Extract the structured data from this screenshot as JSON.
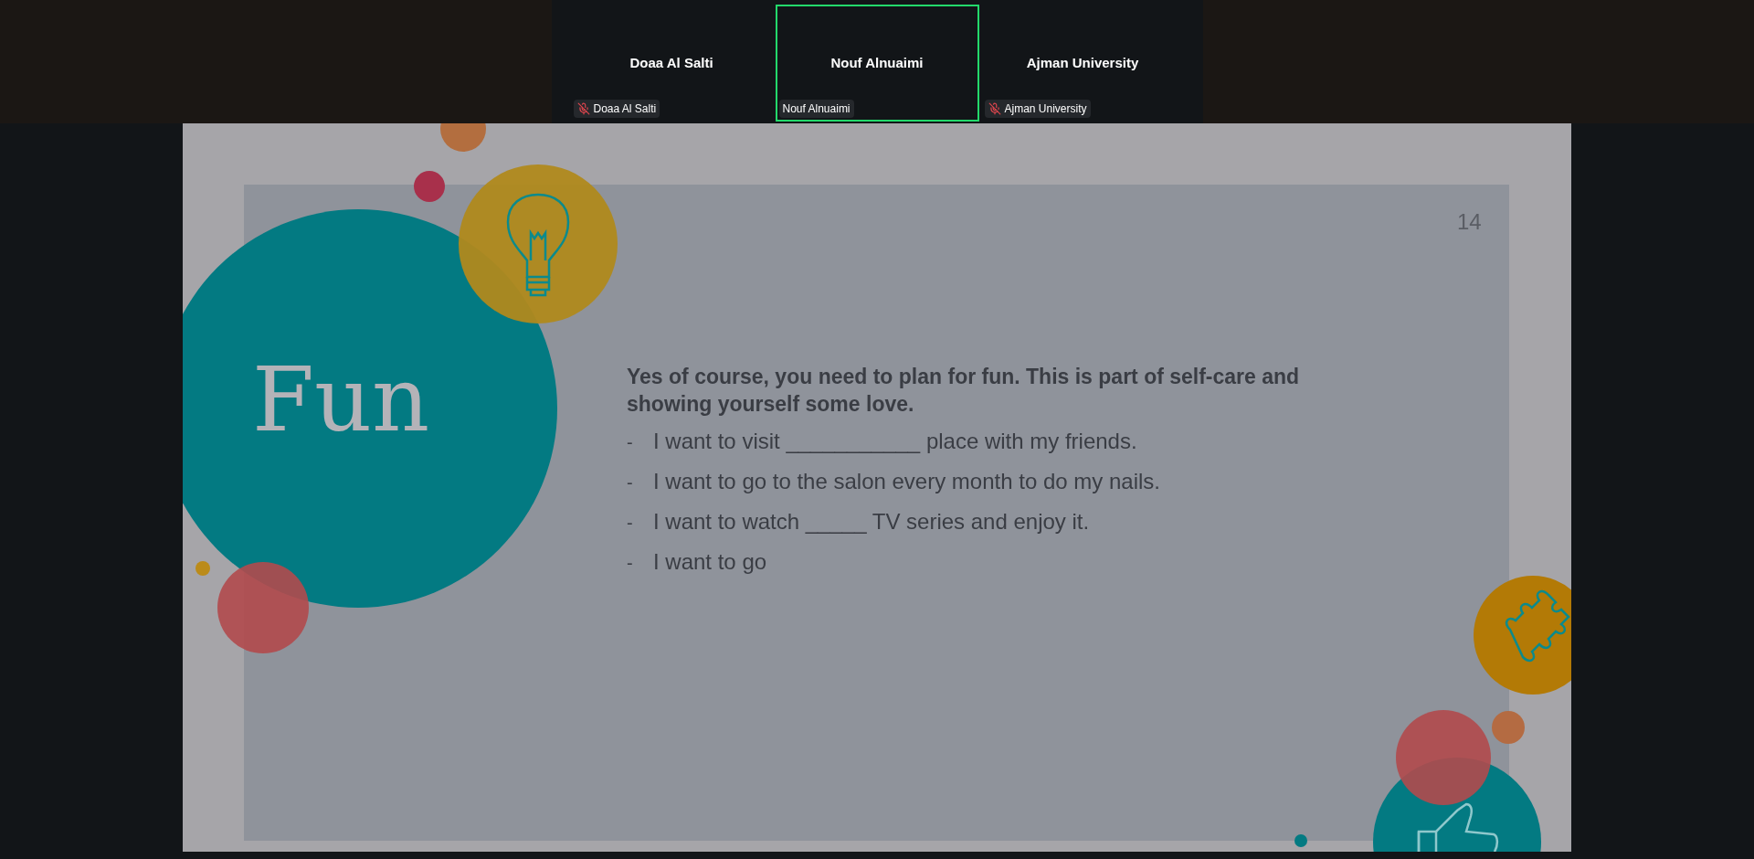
{
  "participants": [
    {
      "name": "Doaa Al Salti",
      "label": "Doaa Al Salti",
      "muted": true,
      "selected": false
    },
    {
      "name": "Nouf Alnuaimi",
      "label": "Nouf Alnuaimi",
      "muted": false,
      "selected": true
    },
    {
      "name": "Ajman University",
      "label": "Ajman University",
      "muted": true,
      "selected": false
    }
  ],
  "slide": {
    "title": "Fun",
    "page_number": "14",
    "intro": "Yes of course, you need to plan for fun. This is part of self-care and showing yourself some love.",
    "items": [
      {
        "bullet": "-",
        "text": "I want to visit ___________ place with my friends."
      },
      {
        "bullet": "-",
        "text": "I want to go to the salon every month to do my nails."
      },
      {
        "bullet": "-",
        "text": "I want to watch _____ TV series and enjoy it."
      },
      {
        "bullet": "-",
        "text": "I want to go"
      }
    ]
  }
}
